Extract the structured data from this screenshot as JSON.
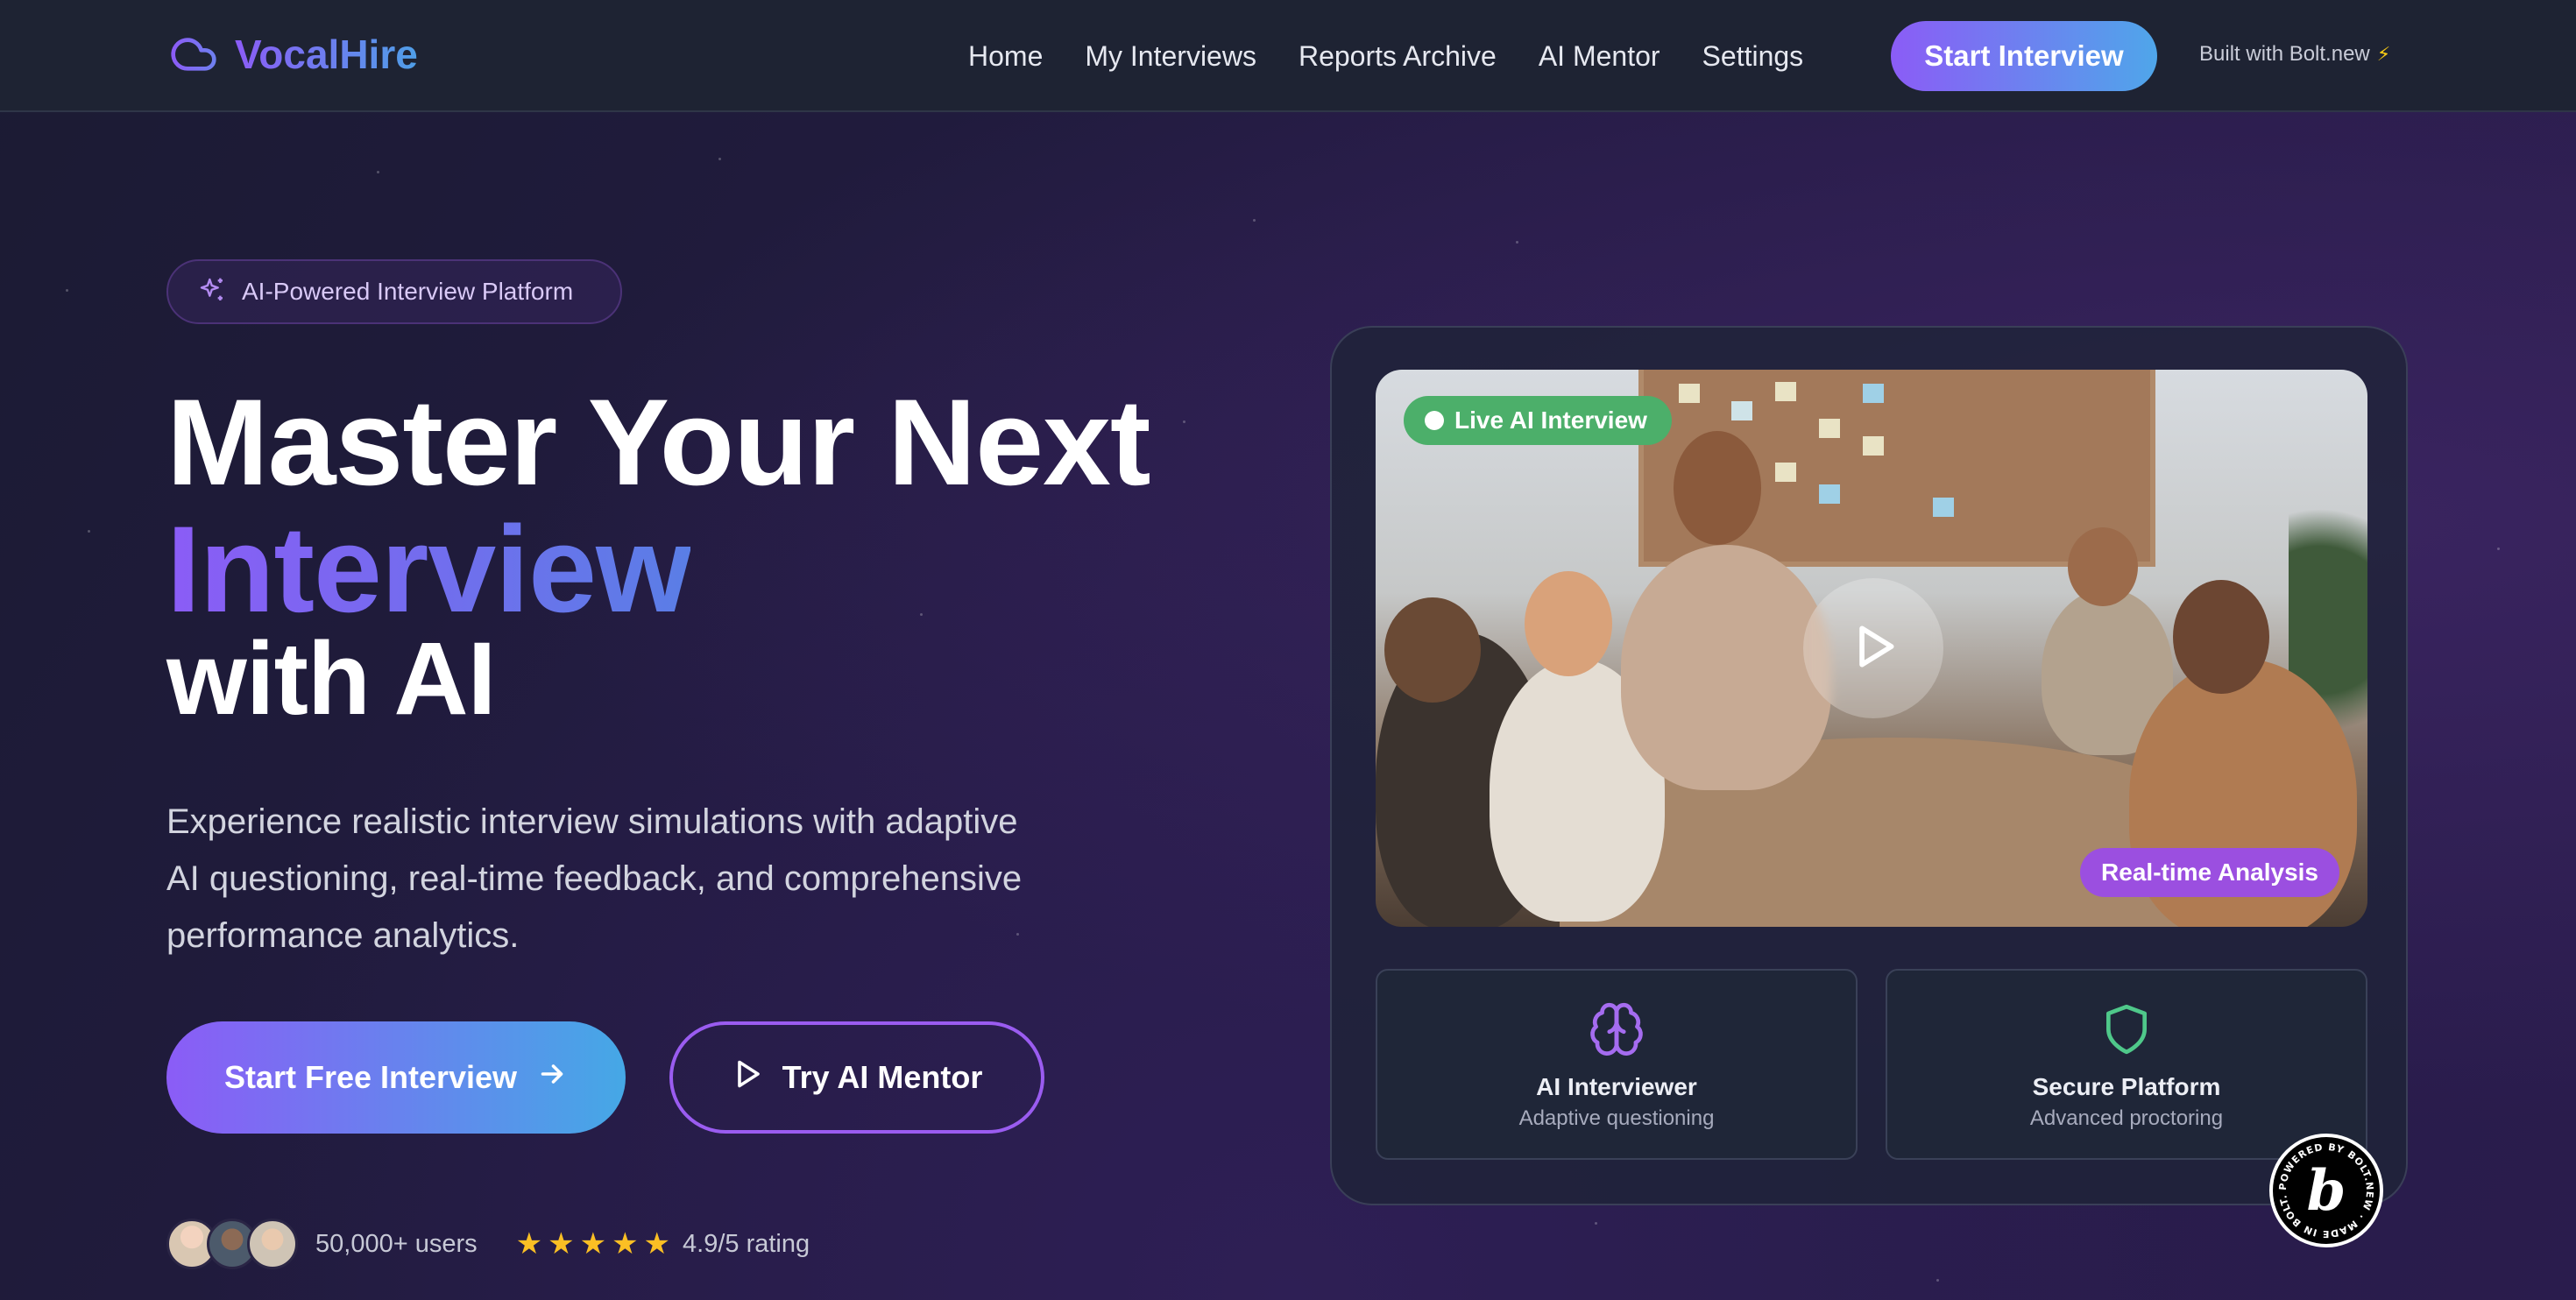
{
  "nav": {
    "brand": "VocalHire",
    "links": [
      "Home",
      "My Interviews",
      "Reports Archive",
      "AI Mentor",
      "Settings"
    ],
    "cta": "Start Interview",
    "built_with": "Built with Bolt.new"
  },
  "hero": {
    "badge": "AI-Powered Interview Platform",
    "title_line1": "Master Your Next",
    "title_line2": "Interview",
    "title_line3": "with AI",
    "description": "Experience realistic interview simulations with adaptive AI questioning, real-time feedback, and comprehensive performance analytics.",
    "primary_button": "Start Free Interview",
    "secondary_button": "Try AI Mentor",
    "users": "50,000+ users",
    "rating_stars": 5,
    "rating": "4.9/5 rating"
  },
  "card": {
    "live_badge": "Live AI Interview",
    "analysis_badge": "Real-time Analysis",
    "features": [
      {
        "title": "AI Interviewer",
        "subtitle": "Adaptive questioning",
        "icon": "brain-icon"
      },
      {
        "title": "Secure Platform",
        "subtitle": "Advanced proctoring",
        "icon": "shield-icon"
      }
    ]
  },
  "bolt_badge": {
    "ring_text": "POWERED BY BOLT.NEW · MADE IN BOLT.NEW · ",
    "letter": "b"
  },
  "colors": {
    "accent_purple": "#8b5cf6",
    "accent_blue": "#4fa6ea",
    "live_green": "#4caf6a",
    "analysis_purple": "#9b4fe0",
    "star": "#fbbf24"
  }
}
